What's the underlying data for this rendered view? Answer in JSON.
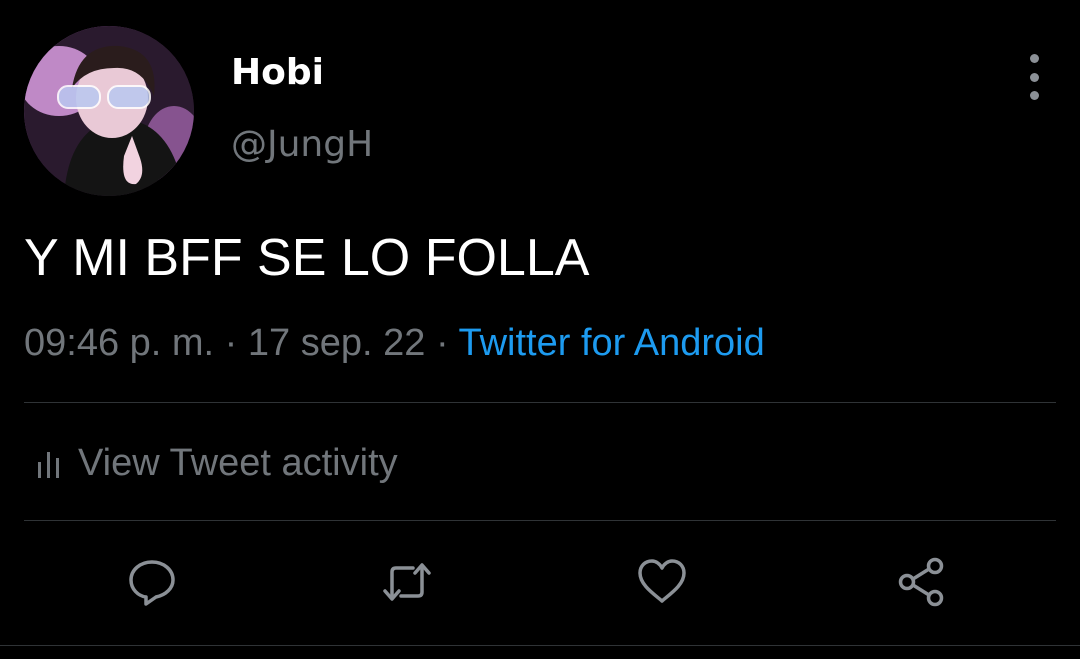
{
  "tweet": {
    "display_name": "Hobi",
    "handle": "@JungH",
    "text": "Y MI BFF SE LO FOLLA",
    "time": "09:46 p. m.",
    "separator": " · ",
    "date": "17 sep. 22",
    "source": "Twitter for Android"
  },
  "activity": {
    "label": "View Tweet activity",
    "icon": "bar-chart-icon"
  },
  "actions": {
    "reply_icon": "reply-icon",
    "retweet_icon": "retweet-icon",
    "like_icon": "heart-icon",
    "share_icon": "share-icon"
  },
  "colors": {
    "background": "#000000",
    "primary_text": "#ffffff",
    "secondary_text": "#71767b",
    "link": "#1d9bf0",
    "divider": "#2f3336"
  }
}
